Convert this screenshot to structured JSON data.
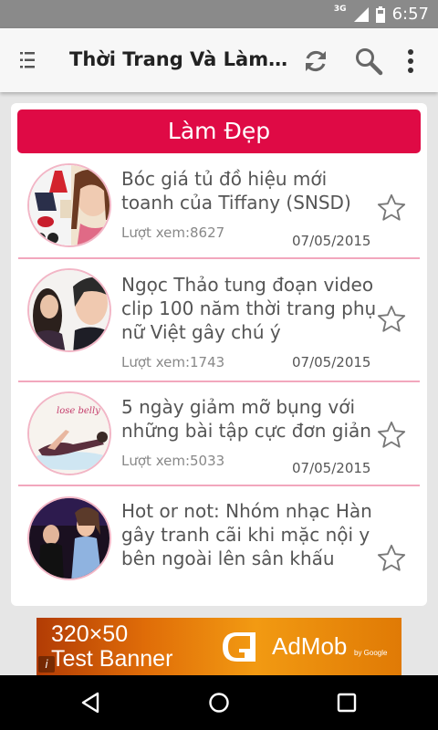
{
  "status_bar": {
    "network": "3G",
    "time": "6:57"
  },
  "app_bar": {
    "title": "Thời Trang Và Làm Đẹp",
    "icons": [
      "menu-icon",
      "refresh-icon",
      "search-icon",
      "overflow-menu-icon"
    ]
  },
  "category": {
    "label": "Làm Đẹp",
    "color": "#df0a45"
  },
  "articles": [
    {
      "title": "Bóc giá tủ đồ hiệu mới toanh của Tiffany (SNSD)",
      "views": "Lượt xem:8627",
      "date": "07/05/2015"
    },
    {
      "title": "Ngọc Thảo tung đoạn video clip 100 năm thời trang phụ nữ Việt gây chú ý",
      "views": "Lượt xem:1743",
      "date": "07/05/2015"
    },
    {
      "title": "5 ngày giảm mỡ bụng với những bài tập cực đơn giản",
      "views": "Lượt xem:5033",
      "date": "07/05/2015"
    },
    {
      "title": "Hot or not: Nhóm nhạc Hàn gây tranh cãi khi mặc nội y bên ngoài lên sân khấu",
      "views": "",
      "date": ""
    }
  ],
  "thumb_texts": {
    "article_3": "lose belly"
  },
  "ad": {
    "size_text": "320×50",
    "type_text": "Test Banner",
    "brand": "AdMob",
    "by": "by Google",
    "info": "i"
  },
  "nav_bar": {
    "icons": [
      "back-icon",
      "home-icon",
      "recents-icon"
    ]
  }
}
